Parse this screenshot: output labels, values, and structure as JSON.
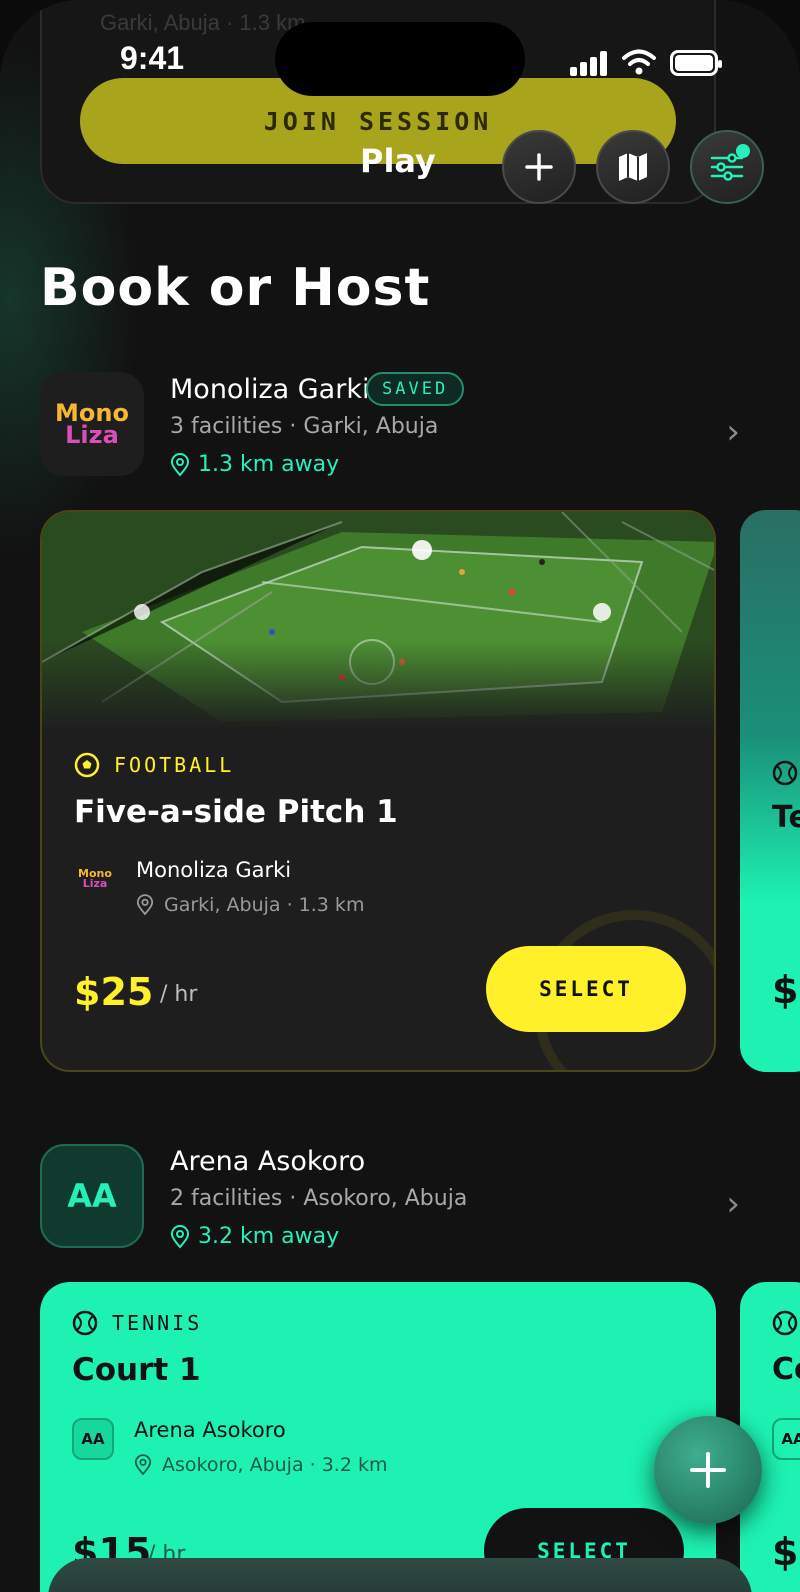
{
  "status": {
    "time": "9:41"
  },
  "ghost_card": {
    "text": "Garki, Abuja · 1.3 km",
    "join_label": "JOIN SESSION"
  },
  "header": {
    "title": "Play",
    "add_icon": "plus-icon",
    "map_icon": "map-icon",
    "filter_icon": "sliders-icon"
  },
  "section_title": "Book or Host",
  "venues": [
    {
      "name": "Monoliza Garki",
      "badge": "SAVED",
      "logo_line1": "Mono",
      "logo_line2": "Liza",
      "meta": "3 facilities · Garki, Abuja",
      "distance": "1.3 km away",
      "facility": {
        "sport": "FOOTBALL",
        "title": "Five-a-side Pitch 1",
        "venue_name": "Monoliza Garki",
        "location": "Garki, Abuja · 1.3 km",
        "price": "$25",
        "per": "/ hr",
        "select_label": "SELECT"
      }
    },
    {
      "name": "Arena Asokoro",
      "logo": "AA",
      "meta": "2 facilities · Asokoro, Abuja",
      "distance": "3.2 km away",
      "facility": {
        "sport": "TENNIS",
        "title": "Court 1",
        "venue_name": "Arena Asokoro",
        "logo": "AA",
        "location": "Asokoro, Abuja · 3.2 km",
        "price": "$15",
        "per": "/ hr",
        "select_label": "SELECT"
      }
    }
  ],
  "side_cards": [
    {
      "title_peek": "Te",
      "price_peek": "$"
    },
    {
      "title_peek": "Co",
      "logo_peek": "AA",
      "price_peek": "$"
    }
  ],
  "colors": {
    "accent": "#26f0b8",
    "mint": "#1df2b2",
    "yellow": "#fff02a",
    "dark": "#121212"
  }
}
